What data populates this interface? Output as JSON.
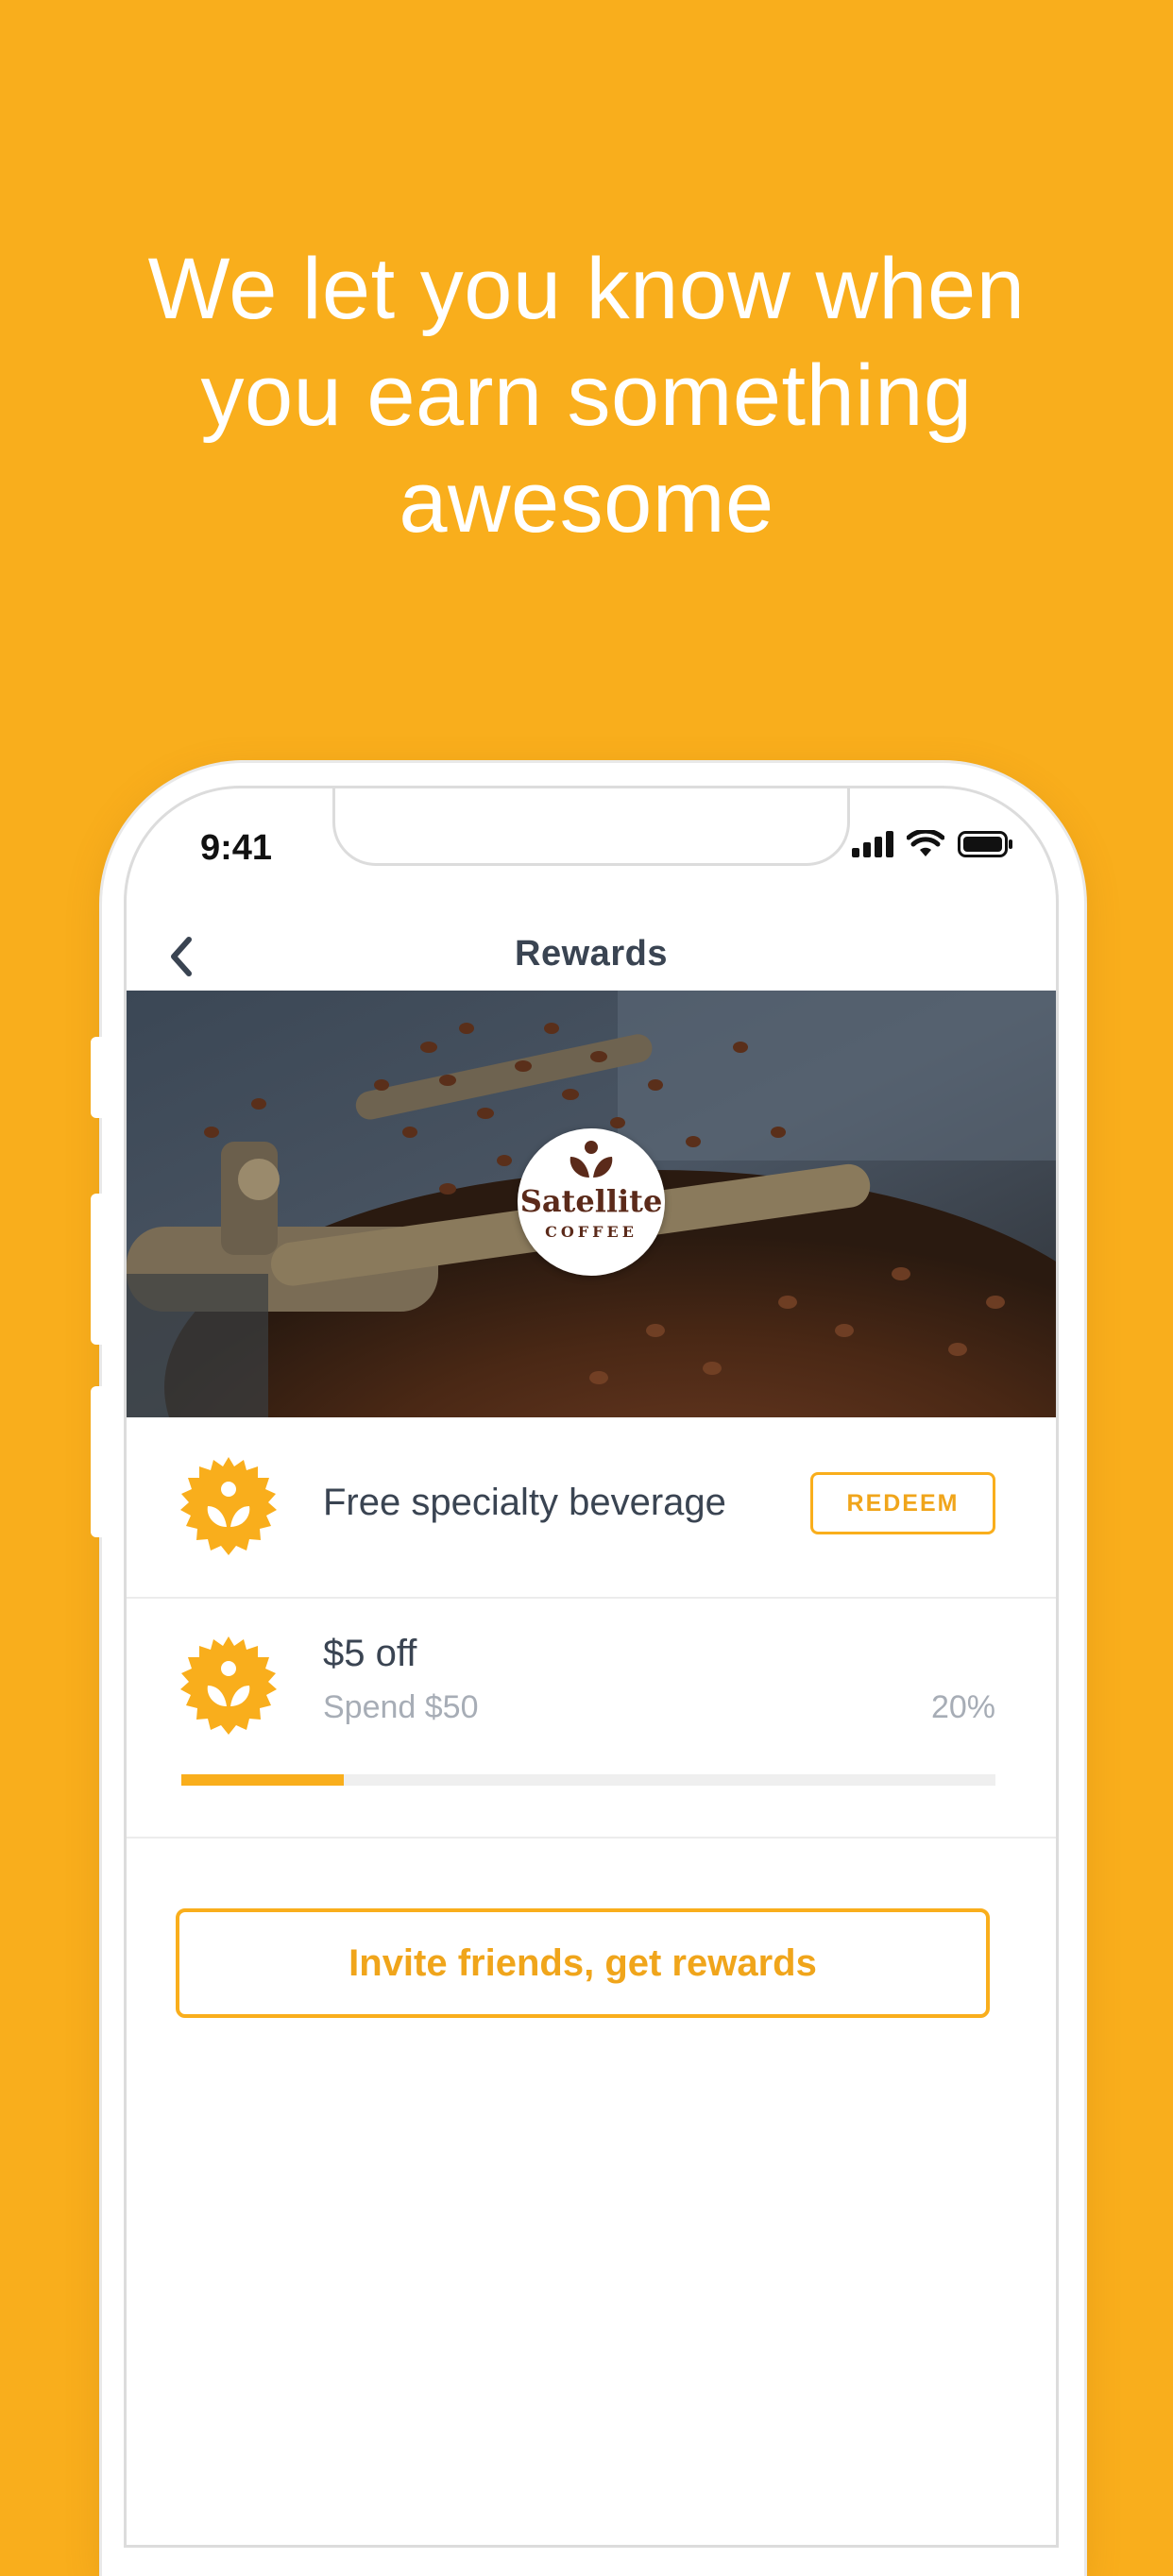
{
  "headline": {
    "line1": "We let you know when",
    "line2": "you earn something",
    "line3": "awesome"
  },
  "status_bar": {
    "time": "9:41"
  },
  "nav": {
    "title": "Rewards",
    "back_icon": "chevron-left-icon"
  },
  "hero": {
    "logo_text": "Satellite",
    "logo_subtext": "COFFEE"
  },
  "rewards": [
    {
      "title": "Free specialty beverage",
      "action_label": "REDEEM"
    },
    {
      "title": "$5 off",
      "subtitle": "Spend $50",
      "progress_label": "20%",
      "progress": 0.2
    }
  ],
  "invite": {
    "label": "Invite friends, get rewards"
  },
  "colors": {
    "accent": "#F9AE1C",
    "text": "#3A4452",
    "muted": "#A7ADB6"
  }
}
